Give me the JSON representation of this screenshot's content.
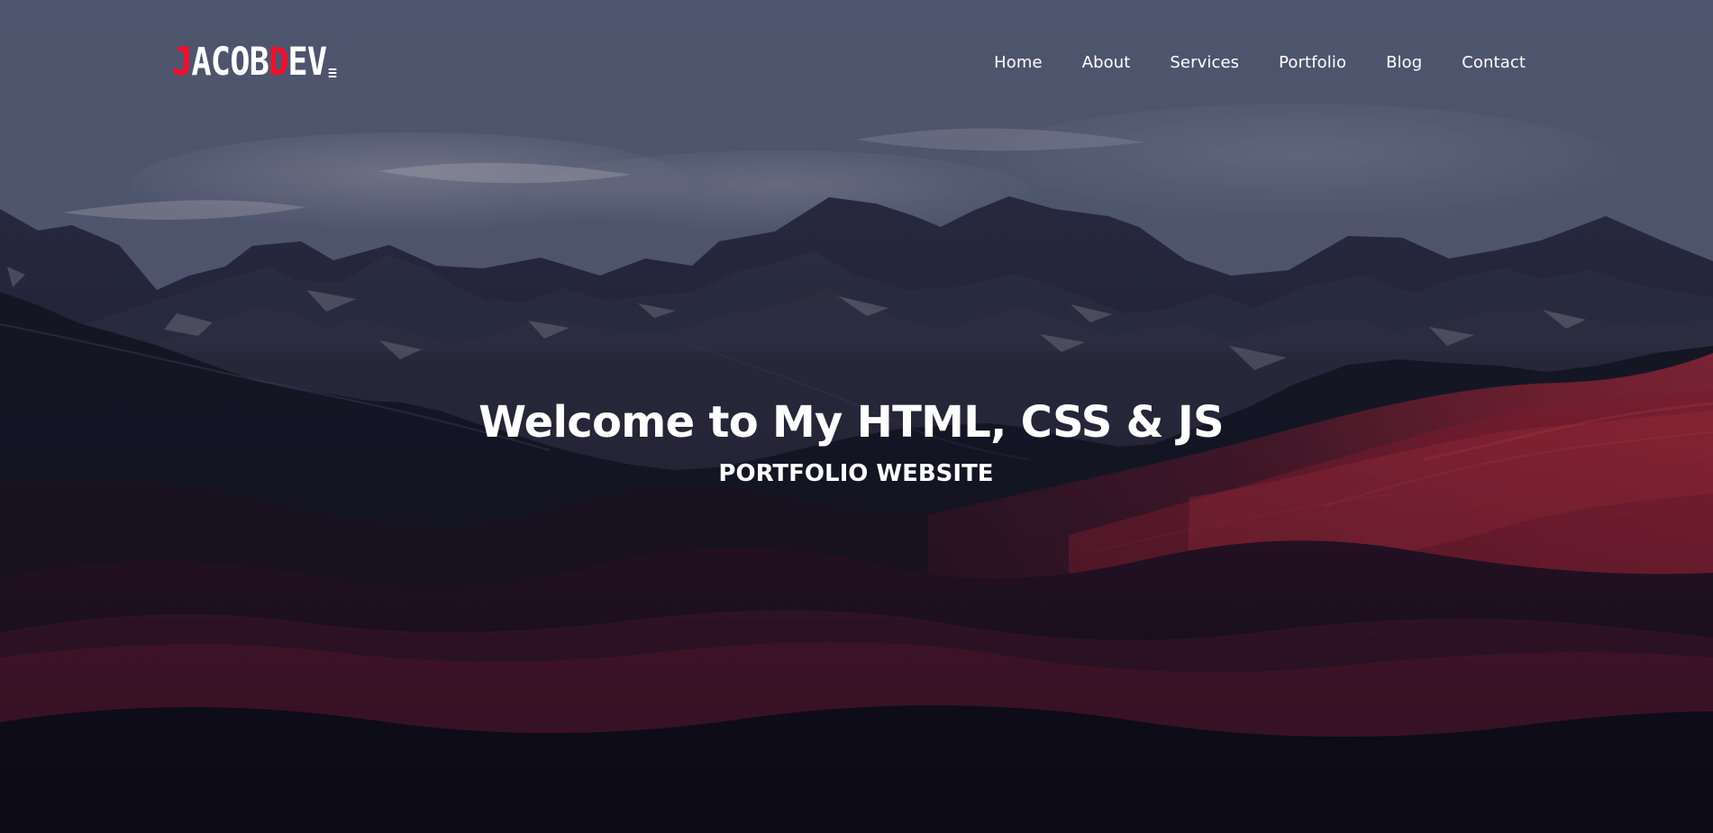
{
  "brand": {
    "logo_text_1": "J",
    "logo_text_2": "ACOB",
    "logo_text_3": "D",
    "logo_text_4": "EV",
    "accent_color": "#ff0a2a"
  },
  "nav": {
    "items": [
      {
        "label": "Home"
      },
      {
        "label": "About"
      },
      {
        "label": "Services"
      },
      {
        "label": "Portfolio"
      },
      {
        "label": "Blog"
      },
      {
        "label": "Contact"
      }
    ]
  },
  "hero": {
    "title": "Welcome to My HTML, CSS & JS",
    "subtitle": "PORTFOLIO WEBSITE",
    "background_image": "mountain-landscape"
  }
}
